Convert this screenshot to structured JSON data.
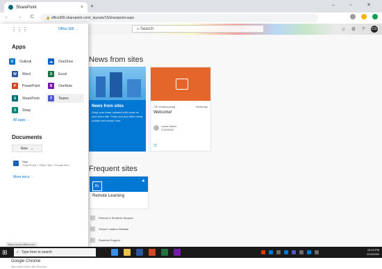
{
  "browser": {
    "tab_title": "SharePoint",
    "url": "office365.sharepoint.com/_layouts/15/sharepoint.aspx",
    "nav_glyphs": "← → C",
    "window_controls": "– ▫ ✕",
    "ext_colors": [
      "#9e9e9e",
      "#f4b400",
      "#0f9d58"
    ]
  },
  "suitebar": {
    "brand": "Office 365",
    "search_placeholder": "Search",
    "avatar_initials": "CS",
    "icons": [
      "bell-icon",
      "gear-icon",
      "help-icon"
    ]
  },
  "launcher": {
    "apps_heading": "Apps",
    "apps": [
      {
        "name": "Outlook",
        "color": "#0072c6",
        "glyph": "O"
      },
      {
        "name": "OneDrive",
        "color": "#0a61c9",
        "glyph": "☁"
      },
      {
        "name": "Word",
        "color": "#2b579a",
        "glyph": "W"
      },
      {
        "name": "Excel",
        "color": "#217346",
        "glyph": "X"
      },
      {
        "name": "PowerPoint",
        "color": "#d24726",
        "glyph": "P"
      },
      {
        "name": "OneNote",
        "color": "#7719aa",
        "glyph": "N"
      },
      {
        "name": "SharePoint",
        "color": "#036c70",
        "glyph": "S"
      },
      {
        "name": "Teams",
        "color": "#5059c9",
        "glyph": "T"
      },
      {
        "name": "Sway",
        "color": "#008272",
        "glyph": "S"
      }
    ],
    "all_apps": "All apps →",
    "docs_heading": "Documents",
    "new_label": "New",
    "doc_title": "Sign",
    "doc_location": "SharePoint » Office 365 » Private files",
    "more_docs": "More docs →",
    "status_url": "https://www.office.com"
  },
  "news": {
    "heading": "News from sites",
    "card1_title": "News from sites",
    "card1_desc": "Keep your team updated with news on your team site. Posts you and other news publish are shown here.",
    "card2_site": "CIP Homecoming",
    "card2_date": "Yesterday",
    "card2_title": "Welcome!",
    "card2_author": "Laura Admin",
    "card2_author_date": "2/19/2020"
  },
  "frequent": {
    "heading": "Frequent sites",
    "card_initials": "RL",
    "card_name": "Remote Learning",
    "items": [
      "Parents & Students Support",
      "School Leaders Website",
      "Students Support"
    ]
  },
  "taskbar": {
    "search_placeholder": "Type here to search",
    "center_text": "Version 80.0.4000.61",
    "app_colors": [
      "#3a8ee6",
      "#e8c547",
      "#2b579a",
      "#d24726",
      "#217346",
      "#7719aa"
    ],
    "tray_colors": [
      "#d83b01",
      "#0078d4",
      "#6b6b6b",
      "#0078d4",
      "#5059c9",
      "#6b6b6b",
      "#0078d4",
      "#6b6b6b"
    ],
    "time": "10:19 PM",
    "date": "2/24/2020"
  },
  "bottom": {
    "title": "Google Chrome",
    "subtitle": "Microsoft Office 365 Preview"
  }
}
